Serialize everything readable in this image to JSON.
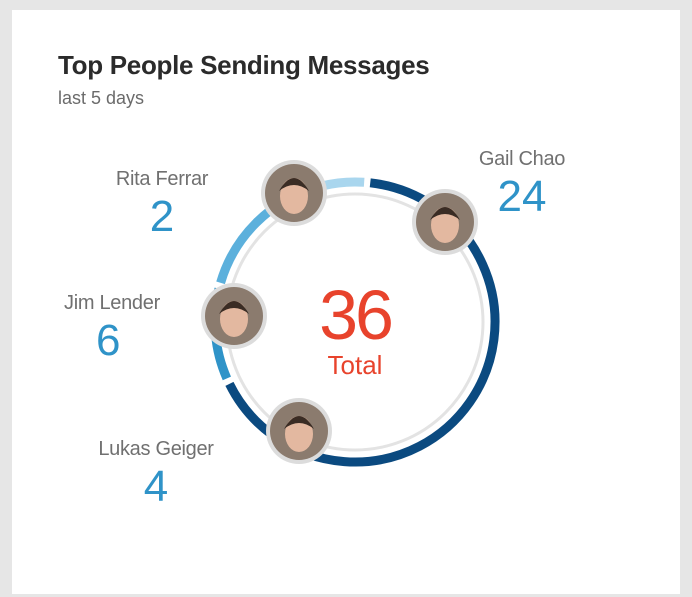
{
  "card": {
    "title": "Top People Sending Messages",
    "subtitle": "last 5 days"
  },
  "total": {
    "value": "36",
    "label": "Total"
  },
  "colors": {
    "title": "#2b2b2b",
    "subtitle": "#6b6b6b",
    "name": "#707070",
    "value": "#2f93c8",
    "total": "#e8432c",
    "ring_inner": "#e3e3e3",
    "segment_dark": "#0b4a80",
    "segment_mid": "#2f93c8",
    "segment_light": "#a9d6ee"
  },
  "chart_data": {
    "type": "pie",
    "title": "Top People Sending Messages",
    "subtitle": "last 5 days",
    "total": 36,
    "series": [
      {
        "name": "Gail Chao",
        "value": 24,
        "color": "#0b4a80"
      },
      {
        "name": "Lukas Geiger",
        "value": 4,
        "color": "#2f93c8"
      },
      {
        "name": "Jim Lender",
        "value": 6,
        "color": "#5cb0dc"
      },
      {
        "name": "Rita Ferrar",
        "value": 2,
        "color": "#a9d6ee"
      }
    ]
  }
}
